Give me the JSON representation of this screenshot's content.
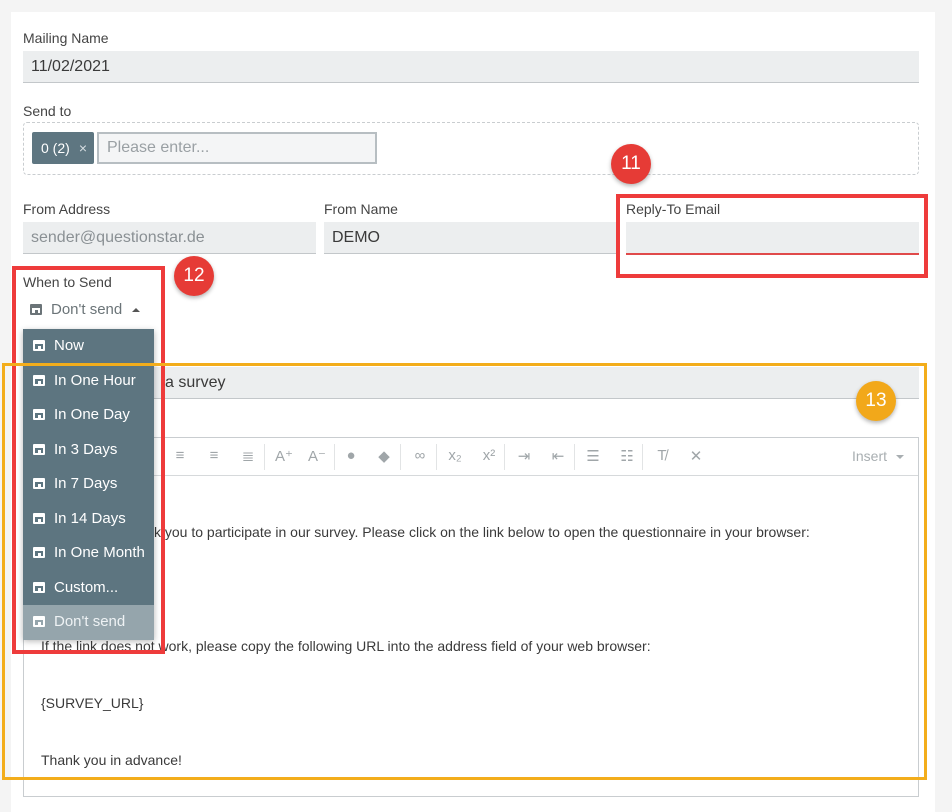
{
  "form": {
    "mailing_name_label": "Mailing Name",
    "mailing_name_value": "11/02/2021",
    "send_to_label": "Send to",
    "send_to_chip": "0 (2)",
    "send_to_chip_remove": "×",
    "send_to_placeholder": "Please enter...",
    "from_address_label": "From Address",
    "from_address_placeholder": "sender@questionstar.de",
    "from_name_label": "From Name",
    "from_name_value": "DEMO",
    "reply_to_label": "Reply-To Email",
    "reply_to_value": "",
    "when_to_send_label": "When to Send",
    "when_to_send_selected": "Don't send"
  },
  "dropdown": {
    "items": [
      "Now",
      "In One Hour",
      "In One Day",
      "In 3 Days",
      "In 7 Days",
      "In 14 Days",
      "In One Month",
      "Custom...",
      "Don't send"
    ],
    "selected": "Don't send"
  },
  "email": {
    "subject_visible": "a survey",
    "toolbar_insert": "Insert",
    "body_lines": [
      "k you to participate in our survey. Please click on the link below to open the questionnaire in your browser:",
      "If the link does not work, please copy the following URL into the address field of your web browser:",
      "{SURVEY_URL}",
      "Thank you in advance!"
    ]
  },
  "annotations": {
    "badge_11": "11",
    "badge_12": "12",
    "badge_13": "13"
  },
  "colors": {
    "annotation_red": "#ee3b3b",
    "annotation_orange": "#f3ad1b",
    "dropdown_bg": "#5d7580",
    "chip_bg": "#5e7681"
  }
}
